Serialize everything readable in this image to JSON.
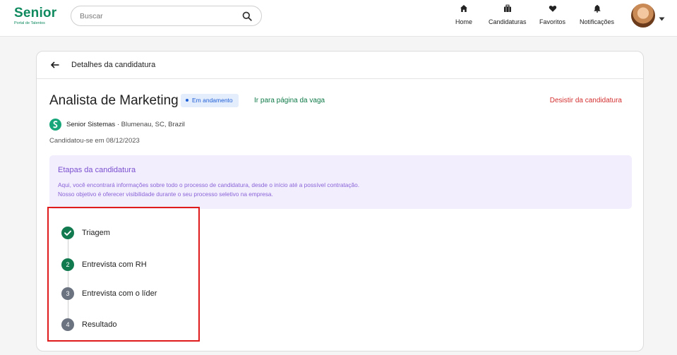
{
  "header": {
    "logo": {
      "name": "Senior",
      "subtitle": "Portal de Talentos"
    },
    "search": {
      "placeholder": "Buscar"
    },
    "nav": [
      {
        "label": "Home",
        "icon": "home-icon"
      },
      {
        "label": "Candidaturas",
        "icon": "briefcase-icon"
      },
      {
        "label": "Favoritos",
        "icon": "heart-icon"
      },
      {
        "label": "Notificações",
        "icon": "bell-icon"
      }
    ],
    "avatar_icon": "user-avatar",
    "menu_icon": "caret-down-icon"
  },
  "card": {
    "title": "Detalhes da candidatura",
    "job": {
      "title": "Analista de Marketing",
      "status": "Em andamento",
      "link": "Ir para página da vaga",
      "withdraw": "Desistir da candidatura",
      "company": "Senior Sistemas",
      "separator": "·",
      "location": "Blumenau, SC, Brazil",
      "applied": "Candidatou-se em 08/12/2023"
    },
    "info": {
      "title": "Etapas da candidatura",
      "line1": "Aqui, você encontrará informações sobre todo o processo de candidatura, desde o início até a possível contratação.",
      "line2": "Nosso objetivo é oferecer visibilidade durante o seu processo seletivo na empresa."
    },
    "steps": [
      {
        "label": "Triagem",
        "number": "",
        "state": "completed"
      },
      {
        "label": "Entrevista com RH",
        "number": "2",
        "state": "current"
      },
      {
        "label": "Entrevista com o líder",
        "number": "3",
        "state": "pending"
      },
      {
        "label": "Resultado",
        "number": "4",
        "state": "pending"
      }
    ]
  },
  "colors": {
    "brand": "#0f8a5f",
    "status_badge_bg": "#e4edfc",
    "status_badge_text": "#1f5fd6",
    "withdraw": "#d32f2f",
    "info_bg": "#f2eefd",
    "info_text": "#8a63d8",
    "step_done": "#117a4f",
    "step_pending": "#6b7280",
    "highlight": "#e01b1b"
  }
}
